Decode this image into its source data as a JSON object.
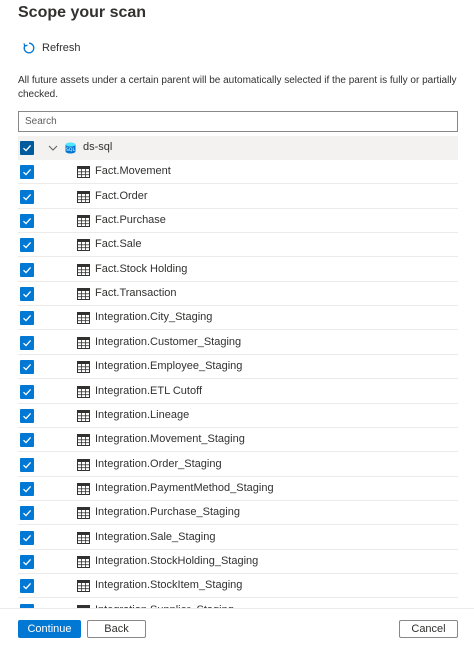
{
  "panel": {
    "title": "Scope your scan",
    "refresh_label": "Refresh",
    "description": "All future assets under a certain parent will be automatically selected if the parent is fully or partially checked.",
    "search_placeholder": "Search"
  },
  "tree": {
    "root": {
      "label": "ds-sql",
      "checked": true,
      "expanded": true
    },
    "items": [
      {
        "label": "Fact.Movement",
        "checked": true
      },
      {
        "label": "Fact.Order",
        "checked": true
      },
      {
        "label": "Fact.Purchase",
        "checked": true
      },
      {
        "label": "Fact.Sale",
        "checked": true
      },
      {
        "label": "Fact.Stock Holding",
        "checked": true
      },
      {
        "label": "Fact.Transaction",
        "checked": true
      },
      {
        "label": "Integration.City_Staging",
        "checked": true
      },
      {
        "label": "Integration.Customer_Staging",
        "checked": true
      },
      {
        "label": "Integration.Employee_Staging",
        "checked": true
      },
      {
        "label": "Integration.ETL Cutoff",
        "checked": true
      },
      {
        "label": "Integration.Lineage",
        "checked": true
      },
      {
        "label": "Integration.Movement_Staging",
        "checked": true
      },
      {
        "label": "Integration.Order_Staging",
        "checked": true
      },
      {
        "label": "Integration.PaymentMethod_Staging",
        "checked": true
      },
      {
        "label": "Integration.Purchase_Staging",
        "checked": true
      },
      {
        "label": "Integration.Sale_Staging",
        "checked": true
      },
      {
        "label": "Integration.StockHolding_Staging",
        "checked": true
      },
      {
        "label": "Integration.StockItem_Staging",
        "checked": true
      },
      {
        "label": "Integration.Supplier_Staging",
        "checked": true
      }
    ]
  },
  "footer": {
    "continue_label": "Continue",
    "back_label": "Back",
    "cancel_label": "Cancel"
  },
  "colors": {
    "accent": "#0078d4",
    "root_checkbox": "#005a9e",
    "root_row_bg": "#f3f2f1"
  },
  "icons": {
    "refresh": "refresh-icon",
    "checkbox": "checkmark-icon",
    "chevron": "chevron-down-icon",
    "database": "sql-database-icon",
    "table": "table-icon"
  }
}
